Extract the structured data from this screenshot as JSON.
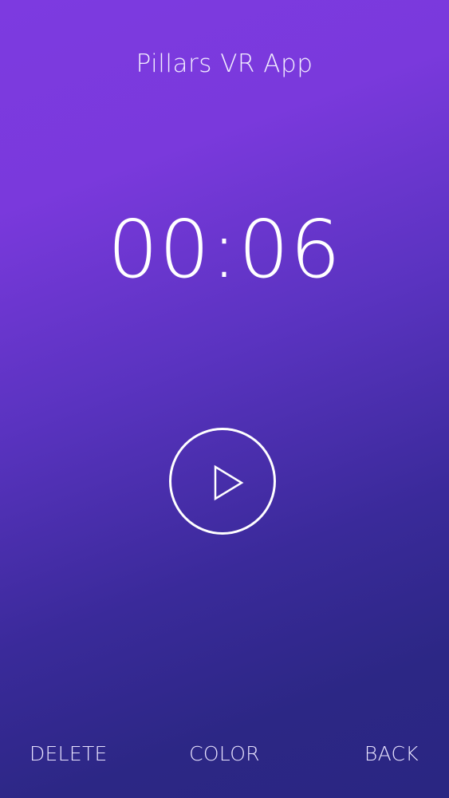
{
  "header": {
    "title": "Pillars VR App"
  },
  "timer": {
    "display": "00:06"
  },
  "controls": {
    "play_icon": "play-icon"
  },
  "bottom_bar": {
    "delete_label": "DELETE",
    "color_label": "COLOR",
    "back_label": "BACK"
  },
  "colors": {
    "gradient_top": "#7d3ae0",
    "gradient_bottom": "#2a2682",
    "foreground": "#ffffff"
  }
}
